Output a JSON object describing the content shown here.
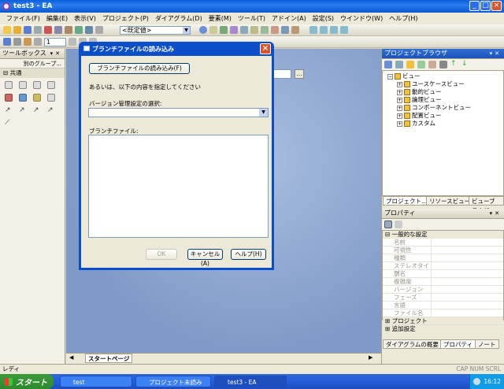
{
  "window": {
    "title": "test3 - EA",
    "min_icon": "minimize-icon",
    "max_icon": "maximize-icon",
    "close_icon": "close-icon"
  },
  "menu": [
    "ファイル(F)",
    "編集(E)",
    "表示(V)",
    "プロジェクト(P)",
    "ダイアグラム(D)",
    "要素(M)",
    "ツール(T)",
    "アドイン(A)",
    "設定(S)",
    "ウインドウ(W)",
    "ヘルプ(H)"
  ],
  "toolbar": {
    "default_value": "<既定値>",
    "zoom_value": "1"
  },
  "toolbox": {
    "title": "ツールボックス",
    "group": "別のグループ...",
    "section": "共通"
  },
  "workspace": {
    "tab_start": "スタートページ"
  },
  "dialog": {
    "title": "ブランチファイルの読み込み",
    "load_button": "ブランチファイルの読み込み(F)",
    "or_text": "あるいは、以下の内容を指定してください",
    "vc_label": "バージョン管理設定の選択:",
    "vc_value": "",
    "branch_label": "ブランチファイル:",
    "ok": "OK",
    "cancel": "キャンセル(A)",
    "help": "ヘルプ(H)"
  },
  "project_browser": {
    "title": "プロジェクトブラウザ",
    "root": "ビュー",
    "items": [
      "ユースケースビュー",
      "動的ビュー",
      "論理ビュー",
      "コンポーネントビュー",
      "配置ビュー",
      "カスタム"
    ],
    "tabs": [
      "プロジェクト...",
      "リソースビュー",
      "ビューブラウザ"
    ]
  },
  "properties": {
    "title": "プロパティ",
    "group_general": "一般的な設定",
    "fields": [
      "名前",
      "可視性",
      "種類",
      "ステレオタイプ",
      "別名",
      "複雑度",
      "バージョン",
      "フェーズ",
      "言語",
      "ファイル名"
    ],
    "group_project": "プロジェクト",
    "group_extra": "追加設定",
    "tabs": [
      "ダイアグラムの概要",
      "プロパティ",
      "ノート"
    ]
  },
  "status": {
    "text": "レディ",
    "indicators": "CAP NUM SCRL"
  },
  "taskbar": {
    "start": "スタート",
    "tasks": [
      "test",
      "プロジェクト未読み込...",
      "test3 - EA"
    ],
    "clock": "16:12"
  }
}
